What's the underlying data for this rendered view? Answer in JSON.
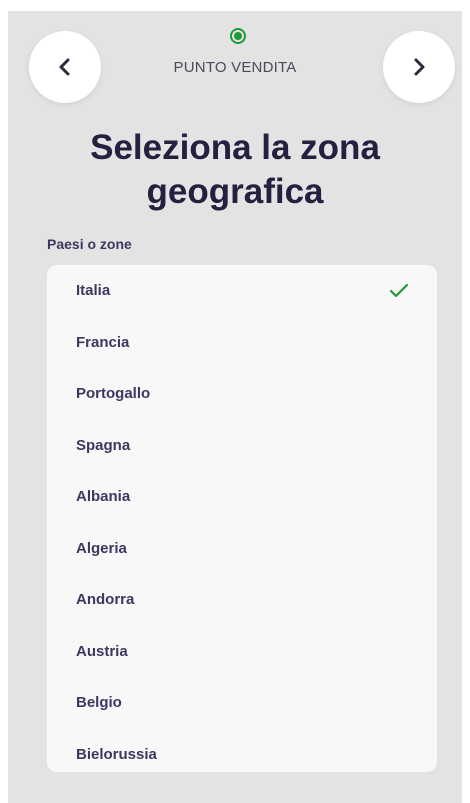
{
  "header": {
    "step_label": "PUNTO VENDITA",
    "prev_icon": "chevron-left-icon",
    "next_icon": "chevron-right-icon",
    "step_indicator_color": "#1f9a3b"
  },
  "title_line1": "Seleziona la zona",
  "title_line2": "geografica",
  "section_label": "Paesi o zone",
  "countries": [
    {
      "label": "Italia",
      "selected": true
    },
    {
      "label": "Francia",
      "selected": false
    },
    {
      "label": "Portogallo",
      "selected": false
    },
    {
      "label": "Spagna",
      "selected": false
    },
    {
      "label": "Albania",
      "selected": false
    },
    {
      "label": "Algeria",
      "selected": false
    },
    {
      "label": "Andorra",
      "selected": false
    },
    {
      "label": "Austria",
      "selected": false
    },
    {
      "label": "Belgio",
      "selected": false
    },
    {
      "label": "Bielorussia",
      "selected": false
    }
  ],
  "colors": {
    "accent_green": "#1f9a3b",
    "title": "#24203f",
    "text": "#3c3860",
    "background": "#e3e3e3",
    "card": "#f8f8f8"
  }
}
